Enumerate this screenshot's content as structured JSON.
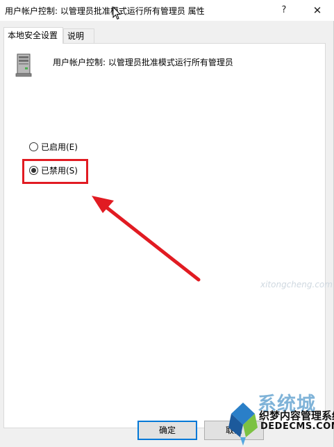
{
  "window": {
    "title": "用户帐户控制: 以管理员批准模式运行所有管理员 属性",
    "help_label": "?",
    "close_label": "✕"
  },
  "tabs": [
    {
      "label": "本地安全设置",
      "active": true
    },
    {
      "label": "说明",
      "active": false
    }
  ],
  "policy": {
    "icon": "server-computer-icon",
    "name": "用户帐户控制: 以管理员批准模式运行所有管理员"
  },
  "options": [
    {
      "label": "已启用(E)",
      "checked": false
    },
    {
      "label": "已禁用(S)",
      "checked": true
    }
  ],
  "buttons": {
    "ok": "确定",
    "cancel": "取消"
  },
  "annotation": {
    "highlight_color": "#e11b22",
    "arrow_color": "#e11b22"
  },
  "watermarks": {
    "main": "系统城",
    "sub1": "织梦内容管理系统",
    "sub2": "DEDECMS.COM",
    "faint": "xitongcheng.com"
  }
}
